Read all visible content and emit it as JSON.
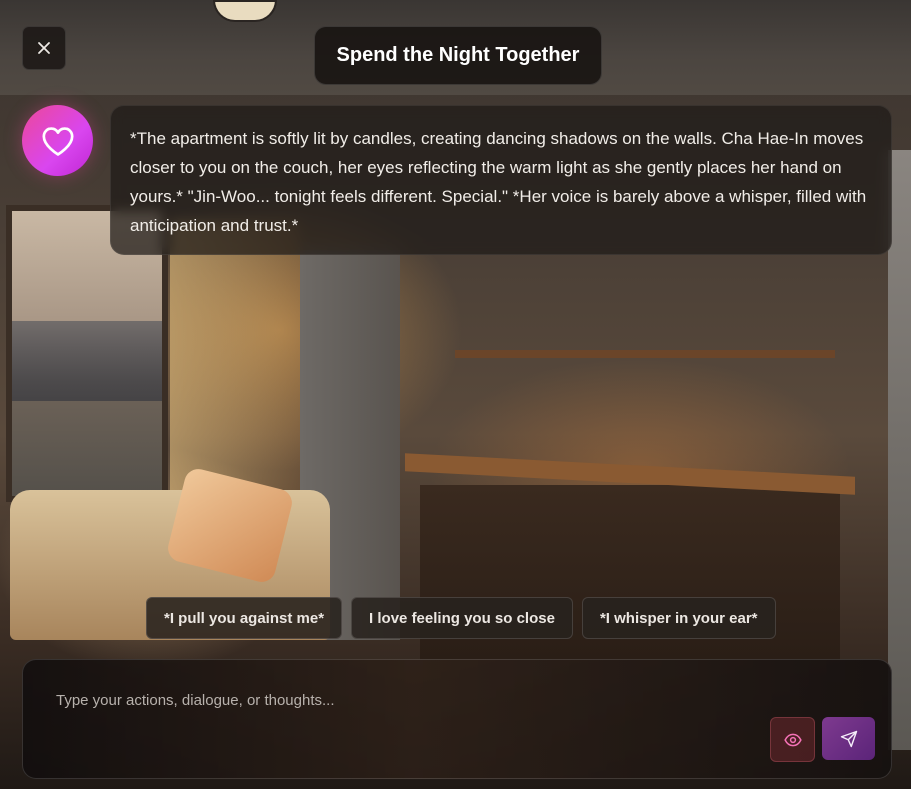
{
  "header": {
    "title": "Spend the Night Together",
    "close_icon": "close-icon"
  },
  "message": {
    "avatar_icon": "heart-icon",
    "text": "*The apartment is softly lit by candles, creating dancing shadows on the walls. Cha Hae-In moves closer to you on the couch, her eyes reflecting the warm light as she gently places her hand on yours.* \"Jin-Woo... tonight feels different. Special.\" *Her voice is barely above a whisper, filled with anticipation and trust.*"
  },
  "suggestions": [
    {
      "label": "*I pull you against me*"
    },
    {
      "label": "I love feeling you so close"
    },
    {
      "label": "*I whisper in your ear*"
    }
  ],
  "composer": {
    "placeholder": "Type your actions, dialogue, or thoughts...",
    "value": "",
    "eye_icon": "eye-icon",
    "send_icon": "send-icon"
  },
  "colors": {
    "avatar_gradient_start": "#ec4899",
    "avatar_gradient_end": "#c026d3",
    "send_button": "#6b2e85",
    "eye_button_tint": "#f472b6"
  }
}
